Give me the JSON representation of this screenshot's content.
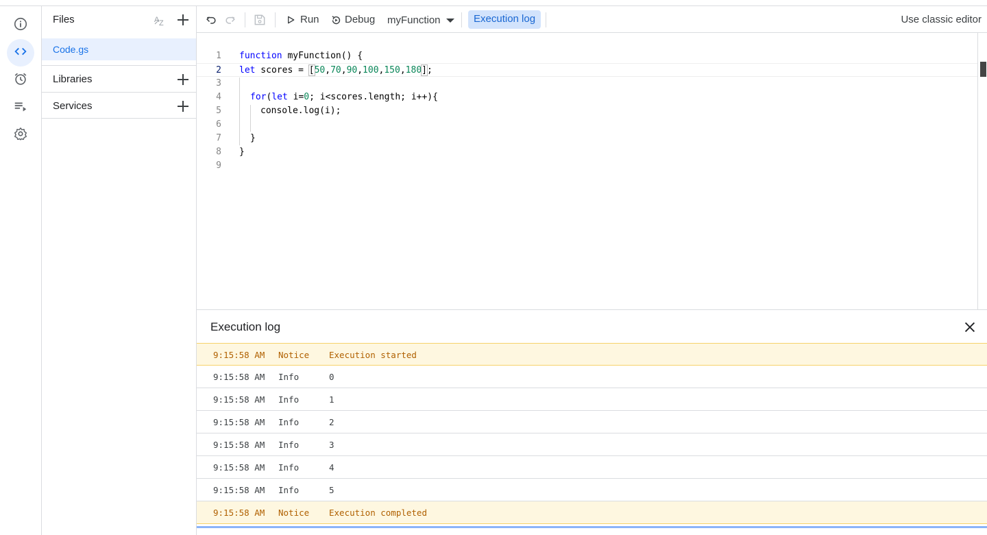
{
  "files_panel": {
    "title": "Files",
    "sort_icon": "sort-az-icon",
    "add_icon": "plus-icon",
    "files": [
      {
        "name": "Code.gs",
        "selected": true
      }
    ],
    "sections": [
      {
        "label": "Libraries"
      },
      {
        "label": "Services"
      }
    ]
  },
  "rail": {
    "items": [
      {
        "name": "overview",
        "icon": "info-icon"
      },
      {
        "name": "editor",
        "icon": "code-icon",
        "active": true
      },
      {
        "name": "triggers",
        "icon": "alarm-clock-icon"
      },
      {
        "name": "executions",
        "icon": "playlist-play-icon"
      },
      {
        "name": "settings",
        "icon": "gear-icon"
      }
    ]
  },
  "toolbar": {
    "run_label": "Run",
    "debug_label": "Debug",
    "function_select": "myFunction",
    "exec_log_label": "Execution log",
    "classic_label": "Use classic editor"
  },
  "editor": {
    "current_line": 2,
    "lines": [
      {
        "n": "1",
        "text": "function myFunction() {"
      },
      {
        "n": "2",
        "text": "let scores = [50,70,90,100,150,180];"
      },
      {
        "n": "3",
        "text": ""
      },
      {
        "n": "4",
        "text": "for(let i=0; i<scores.length; i++){"
      },
      {
        "n": "5",
        "text": "console.log(i);"
      },
      {
        "n": "6",
        "text": ""
      },
      {
        "n": "7",
        "text": "}"
      },
      {
        "n": "8",
        "text": "}"
      },
      {
        "n": "9",
        "text": ""
      }
    ]
  },
  "log": {
    "title": "Execution log",
    "rows": [
      {
        "time": "9:15:58 AM",
        "level": "Notice",
        "msg": "Execution started"
      },
      {
        "time": "9:15:58 AM",
        "level": "Info",
        "msg": "0"
      },
      {
        "time": "9:15:58 AM",
        "level": "Info",
        "msg": "1"
      },
      {
        "time": "9:15:58 AM",
        "level": "Info",
        "msg": "2"
      },
      {
        "time": "9:15:58 AM",
        "level": "Info",
        "msg": "3"
      },
      {
        "time": "9:15:58 AM",
        "level": "Info",
        "msg": "4"
      },
      {
        "time": "9:15:58 AM",
        "level": "Info",
        "msg": "5"
      },
      {
        "time": "9:15:58 AM",
        "level": "Notice",
        "msg": "Execution completed"
      }
    ]
  },
  "colors": {
    "accent": "#1a73e8",
    "notice_bg": "#fef7e0",
    "notice_text": "#b06000",
    "active_bg": "#e8f0fe"
  }
}
